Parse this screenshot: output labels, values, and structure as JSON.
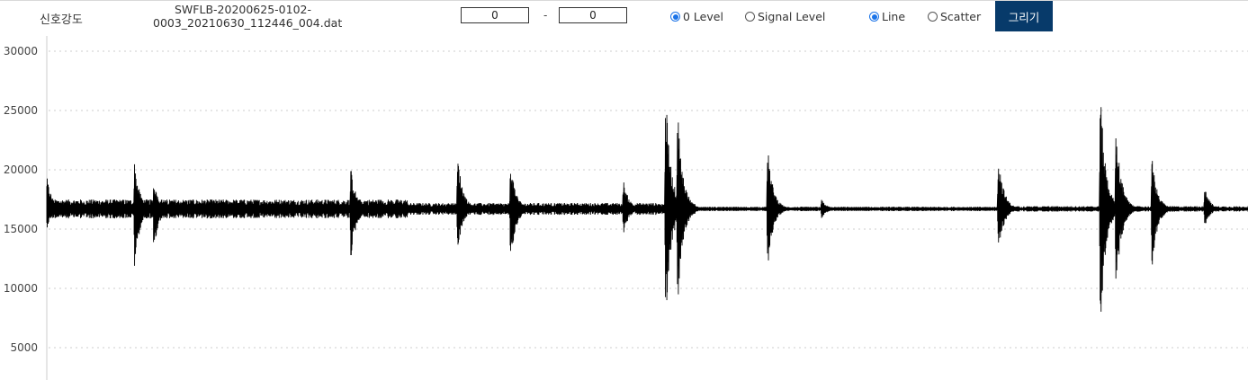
{
  "header": {
    "title": "신호강도",
    "filename_line1": "SWFLB-20200625-0102-",
    "filename_line2": "0003_20210630_112446_004.dat",
    "range_from": "0",
    "range_separator": "-",
    "range_to": "0",
    "radio_zero_level": "0 Level",
    "radio_signal_level": "Signal Level",
    "level_mode_selected": "0 Level",
    "radio_line": "Line",
    "radio_scatter": "Scatter",
    "plot_mode_selected": "Line",
    "draw_button": "그리기"
  },
  "colors": {
    "accent": "#1a73e8",
    "button_bg": "#073a6a",
    "trace": "#000000",
    "grid": "#cccccc"
  },
  "chart_data": {
    "type": "line",
    "ylim": [
      3000,
      30000
    ],
    "xlim": [
      0,
      1
    ],
    "y_ticks": [
      5000,
      10000,
      15000,
      20000,
      25000,
      30000
    ],
    "y_tick_labels": [
      "5000",
      "10000",
      "15000",
      "20000",
      "25000",
      "30000"
    ],
    "grid": true,
    "baseline": 16700,
    "noise_levels": [
      [
        0.0,
        0.3,
        800
      ],
      [
        0.3,
        0.54,
        500
      ],
      [
        0.54,
        0.8,
        180
      ],
      [
        0.8,
        1.0,
        230
      ]
    ],
    "events": [
      {
        "x": 0.0,
        "max": 19500,
        "min": 15000
      },
      {
        "x": 0.073,
        "max": 20700,
        "min": 11600
      },
      {
        "x": 0.089,
        "max": 19000,
        "min": 13000
      },
      {
        "x": 0.253,
        "max": 20300,
        "min": 12300
      },
      {
        "x": 0.342,
        "max": 21400,
        "min": 13000
      },
      {
        "x": 0.386,
        "max": 20800,
        "min": 11800
      },
      {
        "x": 0.48,
        "max": 19200,
        "min": 14500
      },
      {
        "x": 0.515,
        "max": 27000,
        "min": 6700
      },
      {
        "x": 0.525,
        "max": 25500,
        "min": 8000
      },
      {
        "x": 0.6,
        "max": 22100,
        "min": 11500
      },
      {
        "x": 0.645,
        "max": 17500,
        "min": 15900
      },
      {
        "x": 0.792,
        "max": 21500,
        "min": 12700
      },
      {
        "x": 0.877,
        "max": 27000,
        "min": 6300
      },
      {
        "x": 0.89,
        "max": 24000,
        "min": 9500
      },
      {
        "x": 0.92,
        "max": 21200,
        "min": 11500
      },
      {
        "x": 0.964,
        "max": 18500,
        "min": 15200
      }
    ]
  }
}
